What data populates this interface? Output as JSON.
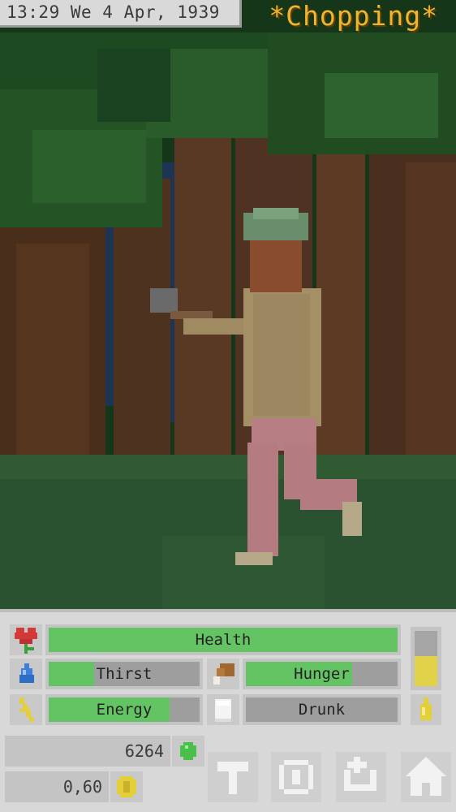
{
  "header": {
    "datetime": "13:29 We 4 Apr, 1939",
    "activity": "*Chopping*"
  },
  "stats": {
    "health": {
      "label": "Health",
      "level": 1.0
    },
    "thirst": {
      "label": "Thirst",
      "level": 0.3
    },
    "hunger": {
      "label": "Hunger",
      "level": 0.7
    },
    "energy": {
      "label": "Energy",
      "level": 0.8
    },
    "drunk": {
      "label": "Drunk",
      "level": 0.0
    },
    "side_gauge_level": 0.55
  },
  "resources": {
    "points": "6264",
    "money": "0,60"
  },
  "icons": {
    "health": "heart-flower-icon",
    "thirst": "water-drop-icon",
    "hunger": "meat-icon",
    "energy": "lightning-icon",
    "drunk": "glass-icon",
    "side": "bottle-icon",
    "points": "green-gem-icon",
    "money": "gold-coin-icon",
    "actions": [
      "hammer-icon",
      "crosshair-icon",
      "back-arrow-icon",
      "home-icon"
    ]
  },
  "colors": {
    "activity": "#f1b42e",
    "bar_fill": "#64c464",
    "gauge_fill": "#e2d24a"
  }
}
